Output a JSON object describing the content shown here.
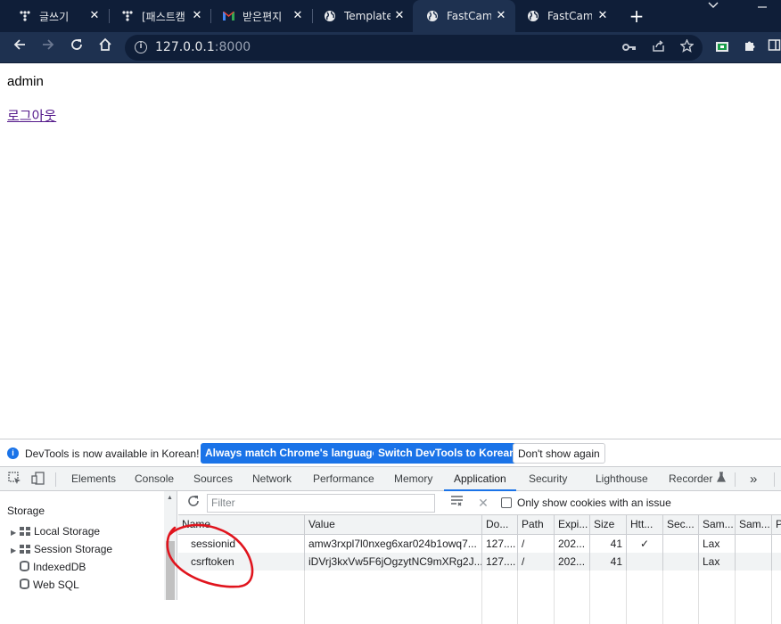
{
  "browser": {
    "tabs": [
      {
        "title": "글쓰기",
        "icon": "tistory-icon",
        "active": false
      },
      {
        "title": "[패스트캠",
        "icon": "tistory-icon",
        "active": false
      },
      {
        "title": "받은편지",
        "icon": "gmail-icon",
        "active": false
      },
      {
        "title": "Template",
        "icon": "globe-icon",
        "active": false
      },
      {
        "title": "FastCamp",
        "icon": "globe-icon",
        "active": true
      },
      {
        "title": "FastCamp",
        "icon": "globe-icon",
        "active": false
      }
    ],
    "url_host": "127.0.0.1",
    "url_port": ":8000",
    "accent_color": "#1e3150"
  },
  "page": {
    "username": "admin",
    "logout_link": "로그아웃"
  },
  "devtools": {
    "infobar": {
      "message": "DevTools is now available in Korean!",
      "btn_match": "Always match Chrome's language",
      "btn_switch": "Switch DevTools to Korean",
      "btn_dismiss": "Don't show again"
    },
    "tabs": [
      "Elements",
      "Console",
      "Sources",
      "Network",
      "Performance",
      "Memory",
      "Application",
      "Security",
      "Lighthouse",
      "Recorder"
    ],
    "active_tab": "Application",
    "more_tabs": "»",
    "sidebar": {
      "title": "Storage",
      "items": [
        "Local Storage",
        "Session Storage",
        "IndexedDB",
        "Web SQL"
      ]
    },
    "cookies": {
      "filter_placeholder": "Filter",
      "only_issue_label": "Only show cookies with an issue",
      "columns": [
        "Name",
        "Value",
        "Do...",
        "Path",
        "Expi...",
        "Size",
        "Htt...",
        "Sec...",
        "Sam...",
        "Sam...",
        "P"
      ],
      "rows": [
        [
          "sessionid",
          "amw3rxpl7l0nxeg6xar024b1owq7...",
          "127....",
          "/",
          "202...",
          "41",
          "✓",
          "",
          "Lax",
          "",
          ""
        ],
        [
          "csrftoken",
          "iDVrj3kxVw5F6jOgzytNC9mXRg2J...",
          "127....",
          "/",
          "202...",
          "41",
          "",
          "",
          "Lax",
          "",
          ""
        ]
      ]
    }
  }
}
